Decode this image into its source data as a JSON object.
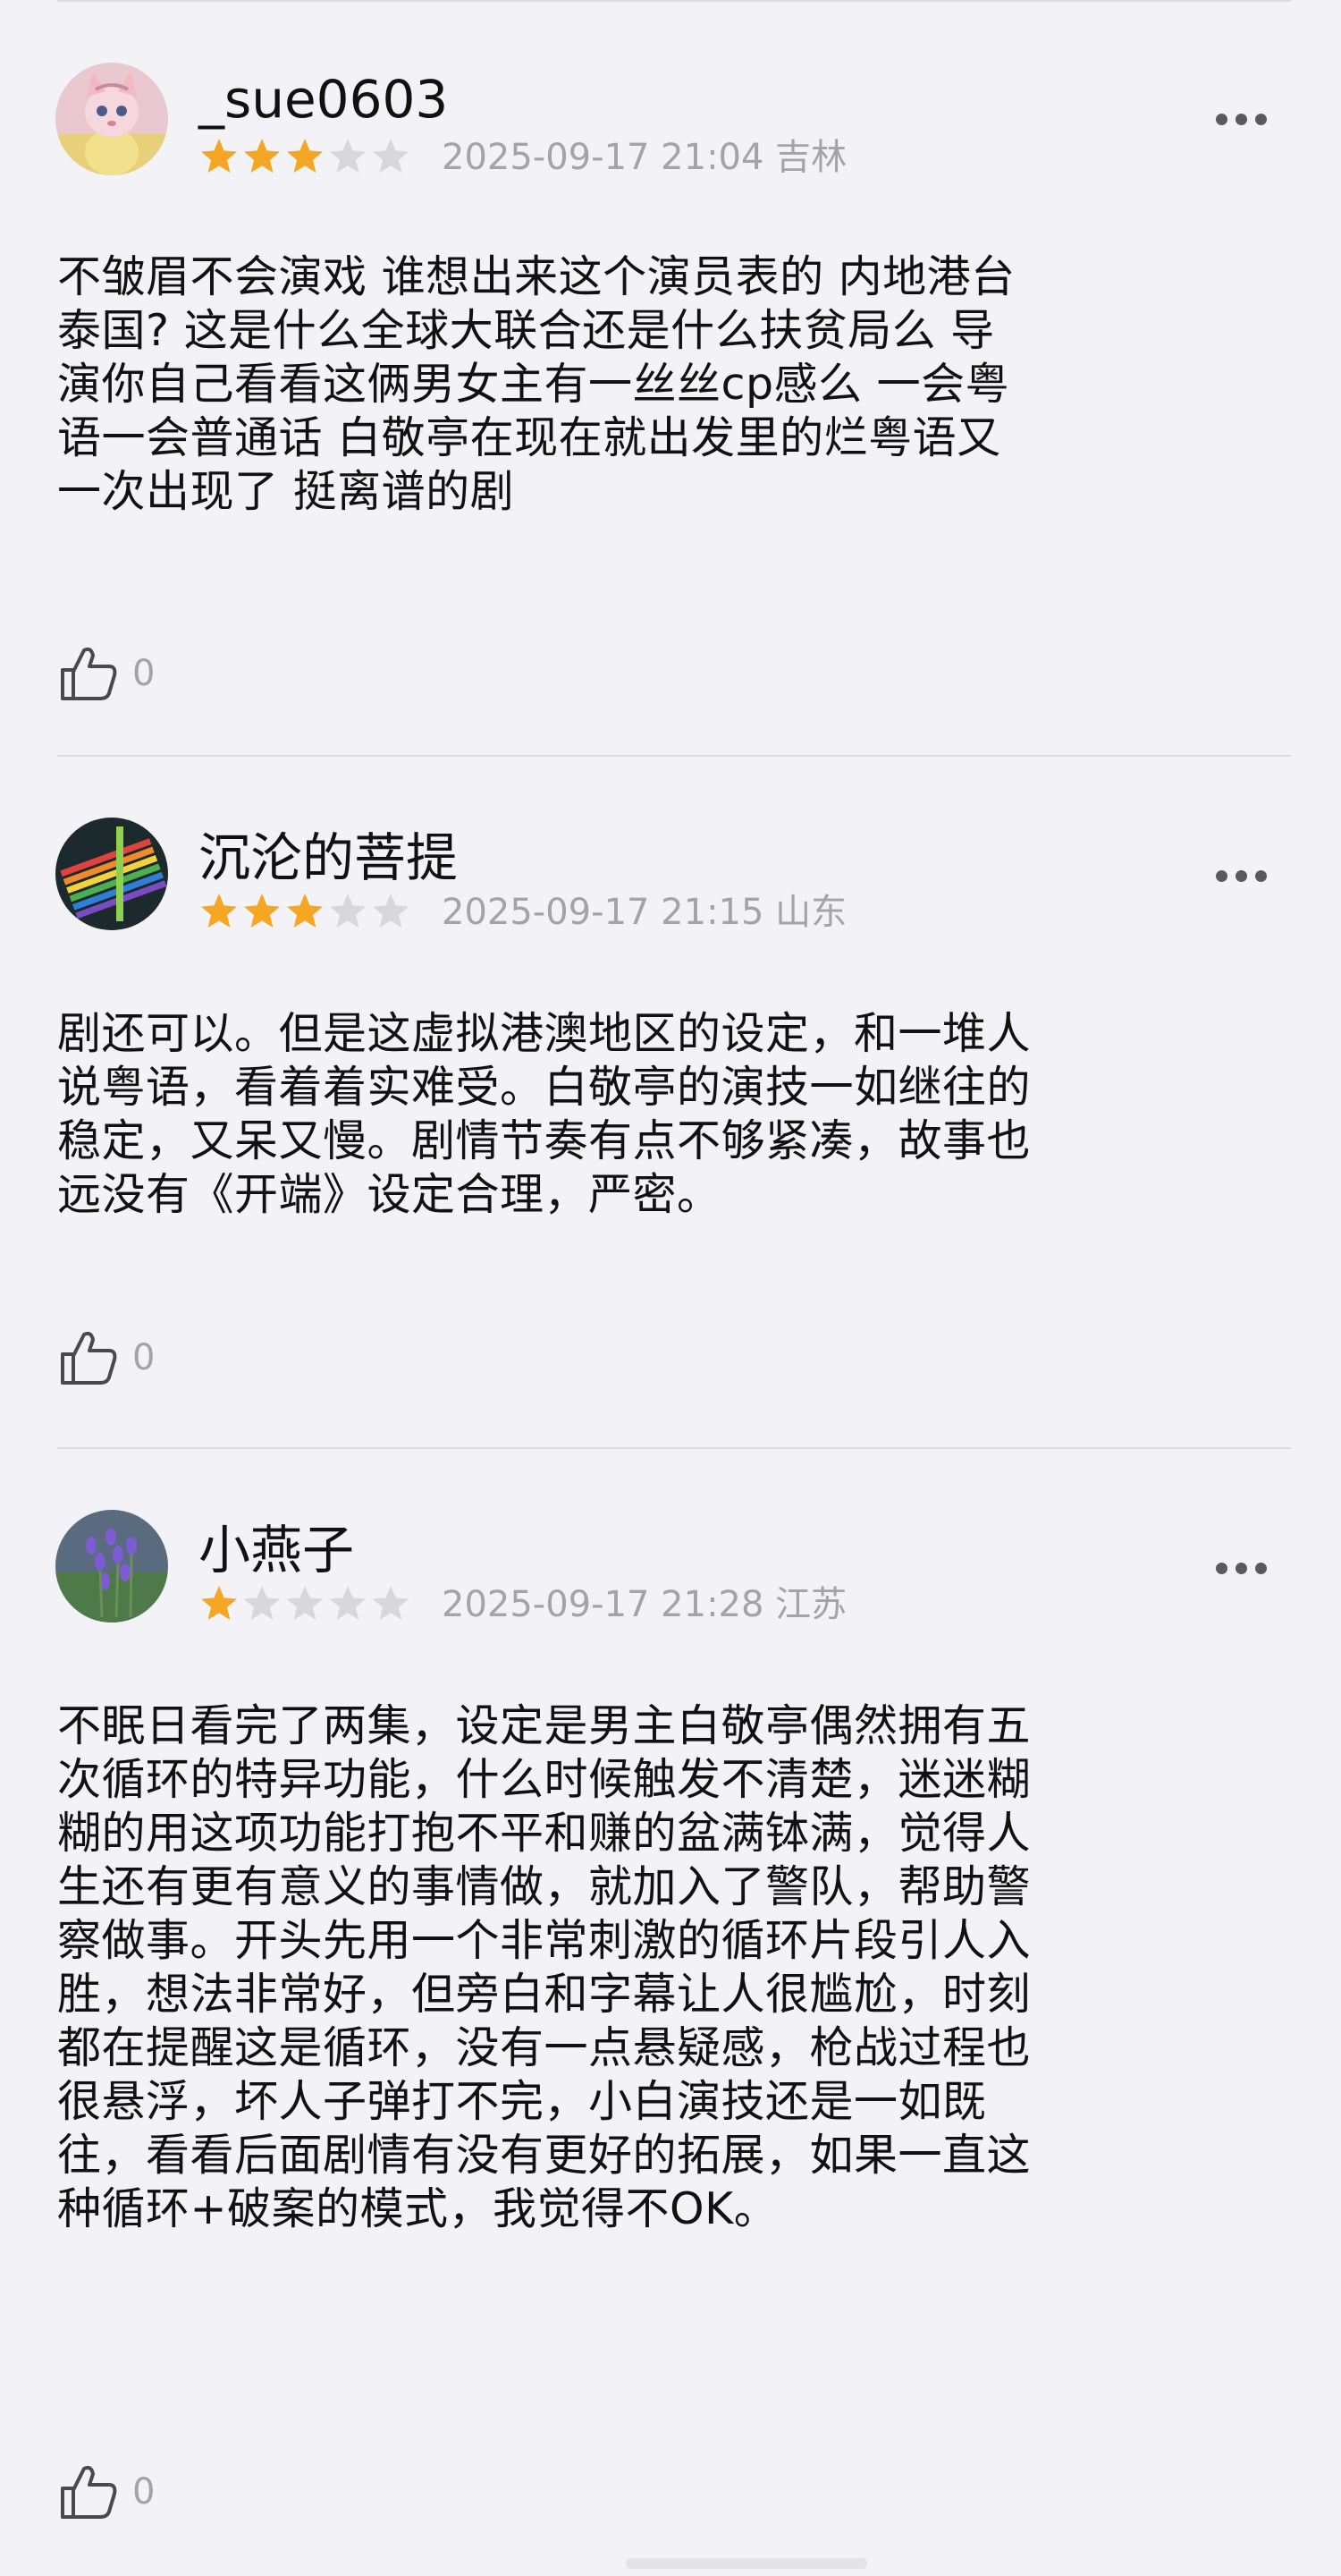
{
  "reviews": [
    {
      "username": "_sue0603",
      "rating": 3,
      "date": "2025-09-17 21:04",
      "location": "吉林",
      "text": "不皱眉不会演戏 谁想出来这个演员表的 内地港台\n泰国? 这是什么全球大联合还是什么扶贫局么 导\n演你自己看看这俩男女主有一丝丝cp感么 一会粤\n语一会普通话 白敬亭在现在就出发里的烂粤语又\n一次出现了 挺离谱的剧",
      "likes": "0",
      "avatar": "pink-fox-avatar"
    },
    {
      "username": "沉沦的菩提",
      "rating": 3,
      "date": "2025-09-17 21:15",
      "location": "山东",
      "text": "剧还可以。但是这虚拟港澳地区的设定，和一堆人\n说粤语，看着着实难受。白敬亭的演技一如继往的\n稳定，又呆又慢。剧情节奏有点不够紧凑，故事也\n远没有《开端》设定合理，严密。",
      "likes": "0",
      "avatar": "colored-pencils-avatar"
    },
    {
      "username": "小燕子",
      "rating": 1,
      "date": "2025-09-17 21:28",
      "location": "江苏",
      "text": "不眠日看完了两集，设定是男主白敬亭偶然拥有五\n次循环的特异功能，什么时候触发不清楚，迷迷糊\n糊的用这项功能打抱不平和赚的盆满钵满，觉得人\n生还有更有意义的事情做，就加入了警队，帮助警\n察做事。开头先用一个非常刺激的循环片段引人入\n胜，想法非常好，但旁白和字幕让人很尴尬，时刻\n都在提醒这是循环，没有一点悬疑感，枪战过程也\n很悬浮，坏人子弹打不完，小白演技还是一如既\n往，看看后面剧情有没有更好的拓展，如果一直这\n种循环+破案的模式，我觉得不OK。",
      "likes": "0",
      "avatar": "lavender-avatar"
    }
  ],
  "colors": {
    "star_filled": "#f5a623",
    "star_empty": "#d8d8dc",
    "meta_text": "#a3a3a8",
    "background": "#f2f2f7"
  },
  "icons": {
    "more": "more-dots-icon",
    "like": "thumbs-up-icon",
    "star": "star-icon"
  }
}
